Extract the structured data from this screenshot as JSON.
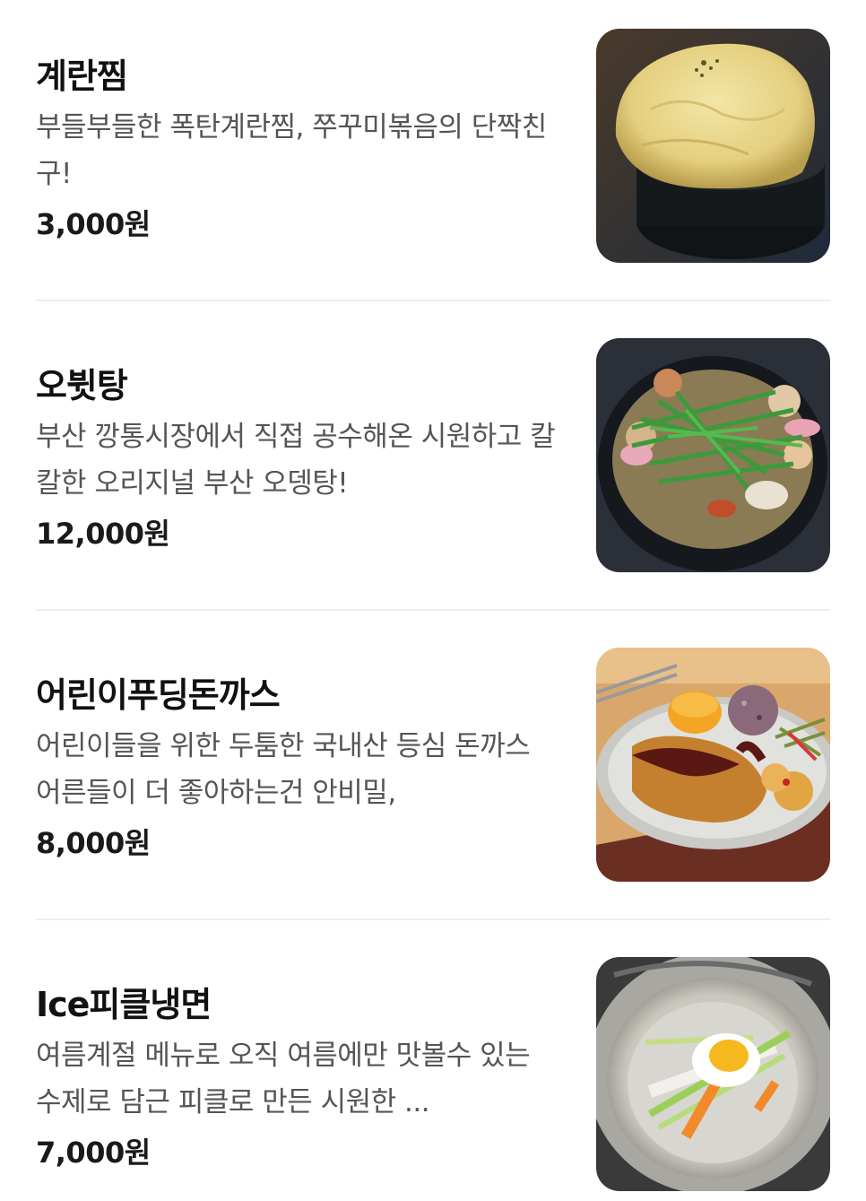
{
  "menu": {
    "items": [
      {
        "name": "계란찜",
        "description": "부들부들한 폭탄계란찜, 쭈꾸미볶음의 단짝친구!",
        "price": "3,000원",
        "image": "steamed-egg-photo"
      },
      {
        "name": "오뷧탕",
        "description": "부산 깡통시장에서 직접 공수해온 시원하고 칼칼한 오리지널 부산 오뎅탕!",
        "price": "12,000원",
        "image": "fishcake-soup-photo"
      },
      {
        "name": "어린이푸딩돈까스",
        "description": "어린이들을 위한 두툼한 국내산 등심 돈까스 어른들이 더 좋아하는건 안비밀,",
        "price": "8,000원",
        "image": "pork-cutlet-plate-photo"
      },
      {
        "name": "Ice피클냉면",
        "description": "여름계절 메뉴로 오직 여름에만 맛볼수 있는 수제로 담근 피클로 만든 시원한 ...",
        "price": "7,000원",
        "image": "cold-noodle-photo"
      }
    ]
  }
}
